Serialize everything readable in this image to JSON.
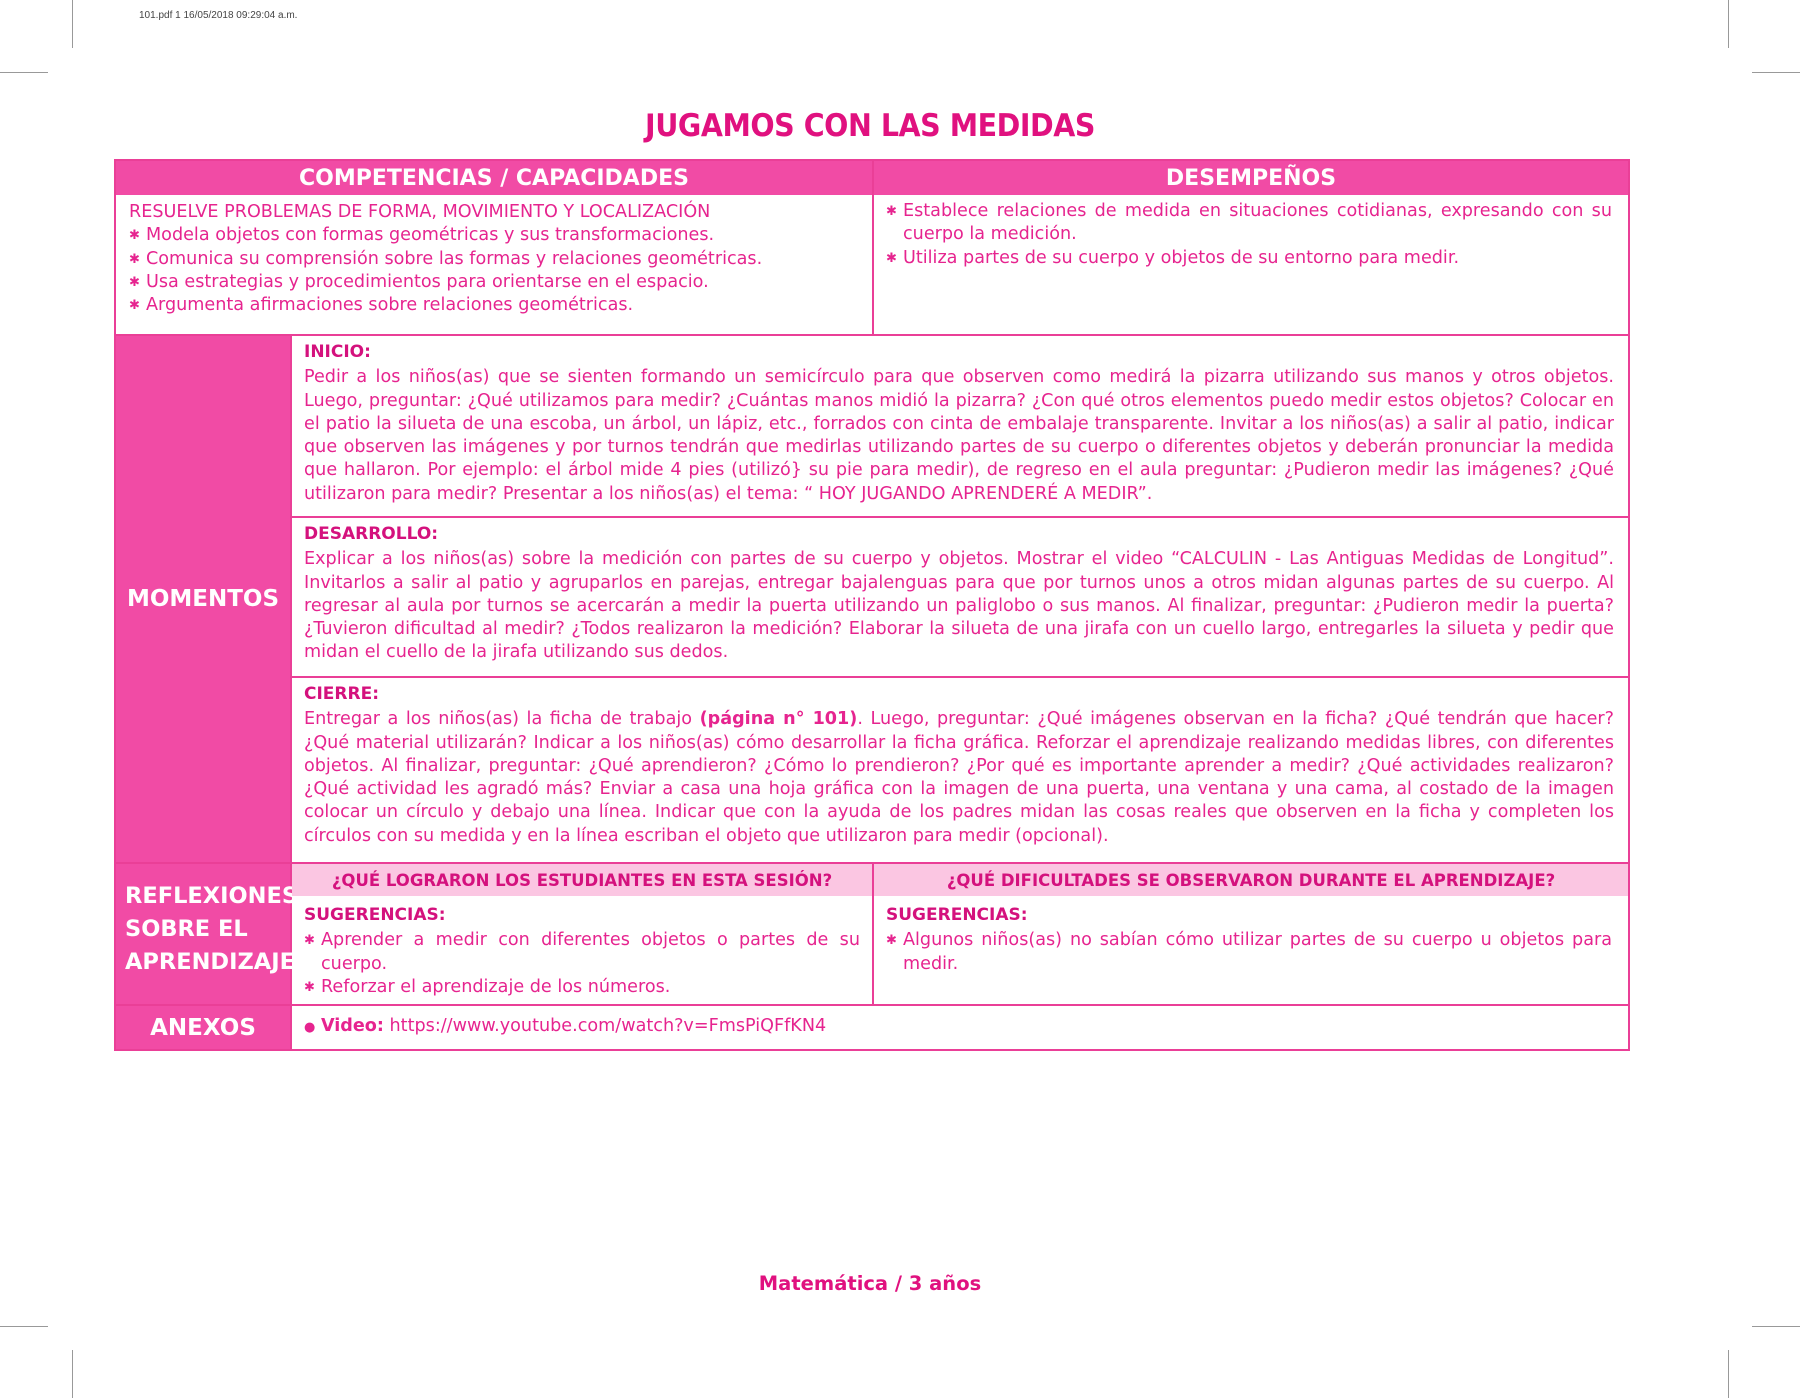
{
  "print_header": "101.pdf   1   16/05/2018   09:29:04 a.m.",
  "title": "JUGAMOS CON LAS MEDIDAS",
  "competencias": {
    "header": "COMPETENCIAS / CAPACIDADES",
    "lead": "RESUELVE PROBLEMAS DE FORMA, MOVIMIENTO Y LOCALIZACIÓN",
    "items": [
      "Modela objetos con formas geométricas y sus transformaciones.",
      "Comunica su comprensión sobre las formas y relaciones geométricas.",
      "Usa estrategias y procedimientos para orientarse en el espacio.",
      "Argumenta afirmaciones sobre relaciones geométricas."
    ]
  },
  "desempenos": {
    "header": "DESEMPEÑOS",
    "items": [
      "Establece relaciones de medida en situaciones cotidianas, expresando con su cuerpo la medición.",
      "Utiliza partes de su cuerpo y objetos de su entorno para medir."
    ]
  },
  "momentos": {
    "label": "MOMENTOS",
    "inicio": {
      "title": "INICIO:",
      "text": "Pedir a los niños(as) que se sienten formando un semicírculo para que observen como medirá la pizarra utilizando sus manos y otros objetos. Luego, preguntar: ¿Qué utilizamos para medir? ¿Cuántas manos midió la pizarra? ¿Con qué otros elementos puedo medir estos objetos? Colocar en el patio la silueta de una escoba, un árbol, un lápiz, etc., forrados con cinta de embalaje transparente. Invitar a los niños(as) a salir al patio, indicar que observen las imágenes y por turnos tendrán que medirlas utilizando partes de su cuerpo o diferentes objetos y deberán pronunciar la medida que hallaron. Por ejemplo: el árbol mide 4 pies (utilizó} su pie para medir), de regreso en el aula preguntar: ¿Pudieron medir las imágenes? ¿Qué utilizaron para medir? Presentar a los niños(as) el tema: “ HOY JUGANDO APRENDERÉ A MEDIR”."
    },
    "desarrollo": {
      "title": "DESARROLLO:",
      "text": "Explicar a los  niños(as) sobre la medición con partes de su cuerpo y objetos. Mostrar el video “CALCULIN - Las Antiguas Medidas de Longitud”. Invitarlos a salir al patio y agruparlos en parejas, entregar bajalenguas para que por turnos unos a otros midan algunas partes de su cuerpo. Al regresar al aula por turnos se acercarán a medir la puerta utilizando un paliglobo o sus manos. Al finalizar, preguntar: ¿Pudieron medir la puerta? ¿Tuvieron dificultad al medir? ¿Todos realizaron la medición? Elaborar la silueta de una jirafa con un cuello largo, entregarles la silueta y pedir que midan el cuello de la jirafa utilizando sus dedos."
    },
    "cierre": {
      "title": "CIERRE:",
      "text_before": "Entregar a los niños(as) la ficha de trabajo ",
      "text_bold": "(página n° 101)",
      "text_after": ". Luego, preguntar: ¿Qué imágenes observan en la ficha? ¿Qué tendrán que hacer? ¿Qué material utilizarán? Indicar a los niños(as) cómo desarrollar la ficha gráfica. Reforzar el aprendizaje realizando medidas libres, con diferentes objetos. Al finalizar, preguntar: ¿Qué aprendieron? ¿Cómo lo prendieron? ¿Por qué es importante aprender a medir? ¿Qué actividades realizaron? ¿Qué actividad les agradó más? Enviar a casa una hoja gráfica con la imagen de una puerta, una ventana y una cama, al costado de la imagen colocar un círculo y debajo una línea. Indicar que con la ayuda de los padres midan las cosas reales que observen en la ficha y completen los círculos con su medida y en la línea escriban el objeto que utilizaron para medir (opcional)."
    }
  },
  "reflexiones": {
    "label": "REFLEXIONES SOBRE EL APRENDIZAJE",
    "logros": {
      "header": "¿QUÉ LOGRARON LOS ESTUDIANTES EN ESTA SESIÓN?",
      "title": "SUGERENCIAS:",
      "items": [
        "Aprender a medir con diferentes objetos o partes de su cuerpo.",
        "Reforzar el aprendizaje de los números."
      ]
    },
    "dificultades": {
      "header": "¿QUÉ DIFICULTADES SE OBSERVARON DURANTE EL APRENDIZAJE?",
      "title": "SUGERENCIAS:",
      "items": [
        "Algunos niños(as) no sabían cómo utilizar partes de su cuerpo u objetos para medir."
      ]
    }
  },
  "anexos": {
    "label": "ANEXOS",
    "video_label": "Video:",
    "video_url": "https://www.youtube.com/watch?v=FmsPiQFfKN4"
  },
  "footer": "Matemática / 3 años"
}
